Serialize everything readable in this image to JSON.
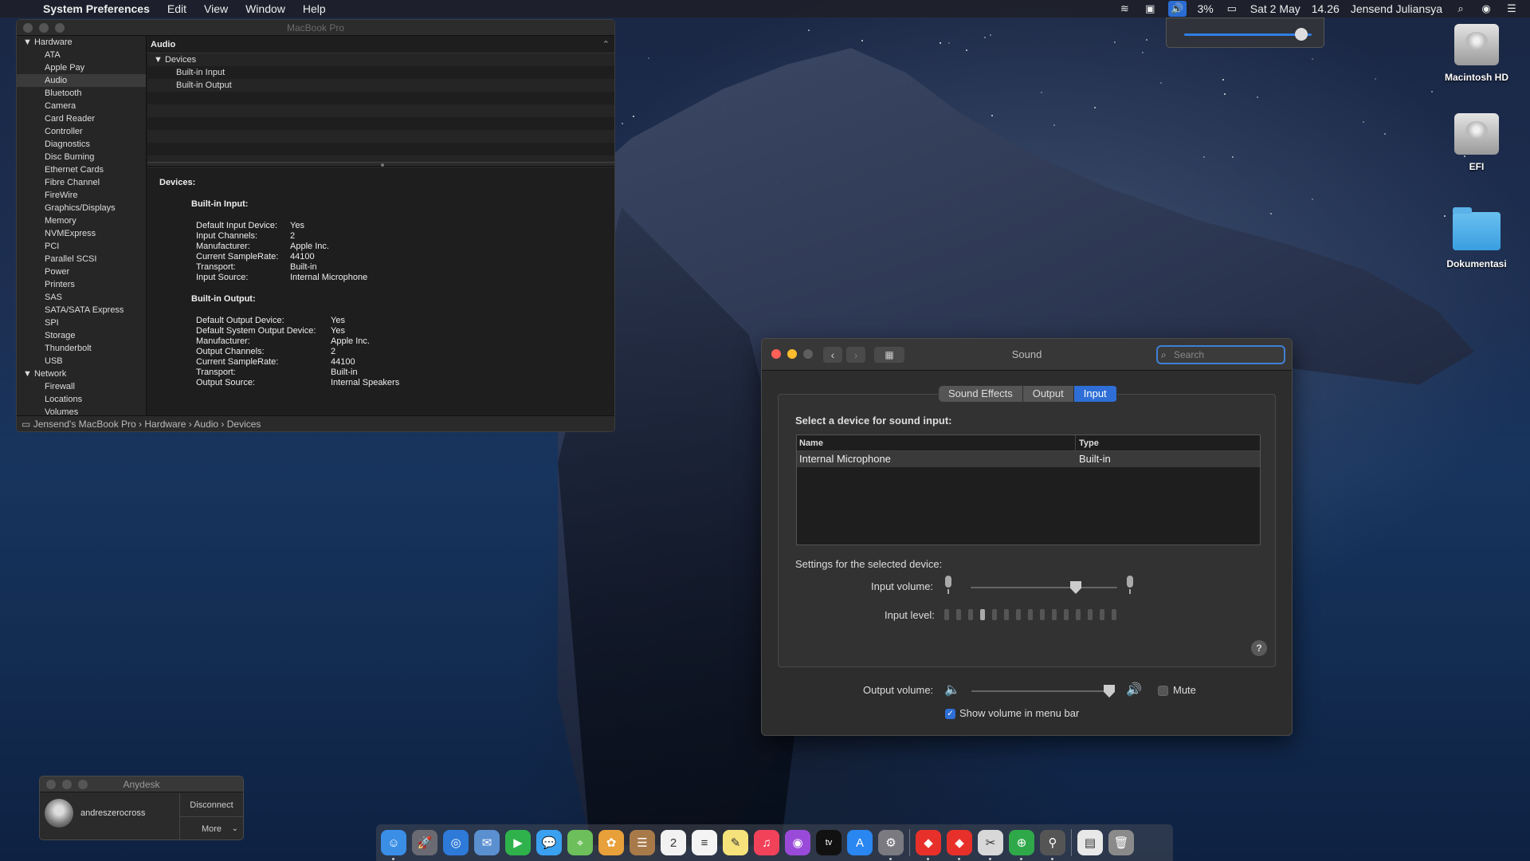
{
  "menubar": {
    "app_name": "System Preferences",
    "menus": [
      "Edit",
      "View",
      "Window",
      "Help"
    ],
    "battery": "3%",
    "date": "Sat 2 May",
    "time": "14.26",
    "user": "Jensend Juliansya"
  },
  "volume_popup": {
    "level_fraction": 0.92
  },
  "desktop_icons": [
    {
      "label": "Macintosh HD",
      "icon": "hard-disk-icon"
    },
    {
      "label": "EFI",
      "icon": "hard-disk-icon"
    },
    {
      "label": "Dokumentasi",
      "icon": "folder-icon"
    }
  ],
  "sysinfo": {
    "title": "MacBook Pro",
    "sidebar": [
      {
        "label": "Hardware",
        "group": true
      },
      {
        "label": "ATA"
      },
      {
        "label": "Apple Pay"
      },
      {
        "label": "Audio",
        "selected": true
      },
      {
        "label": "Bluetooth"
      },
      {
        "label": "Camera"
      },
      {
        "label": "Card Reader"
      },
      {
        "label": "Controller"
      },
      {
        "label": "Diagnostics"
      },
      {
        "label": "Disc Burning"
      },
      {
        "label": "Ethernet Cards"
      },
      {
        "label": "Fibre Channel"
      },
      {
        "label": "FireWire"
      },
      {
        "label": "Graphics/Displays"
      },
      {
        "label": "Memory"
      },
      {
        "label": "NVMExpress"
      },
      {
        "label": "PCI"
      },
      {
        "label": "Parallel SCSI"
      },
      {
        "label": "Power"
      },
      {
        "label": "Printers"
      },
      {
        "label": "SAS"
      },
      {
        "label": "SATA/SATA Express"
      },
      {
        "label": "SPI"
      },
      {
        "label": "Storage"
      },
      {
        "label": "Thunderbolt"
      },
      {
        "label": "USB"
      },
      {
        "label": "Network",
        "group": true
      },
      {
        "label": "Firewall"
      },
      {
        "label": "Locations"
      },
      {
        "label": "Volumes"
      }
    ],
    "list": {
      "header": "Audio",
      "group": "Devices",
      "items": [
        "Built-in Input",
        "Built-in Output"
      ]
    },
    "detail": {
      "heading": "Devices:",
      "input_title": "Built-in Input:",
      "input_rows": [
        [
          "Default Input Device:",
          "Yes"
        ],
        [
          "Input Channels:",
          "2"
        ],
        [
          "Manufacturer:",
          "Apple Inc."
        ],
        [
          "Current SampleRate:",
          "44100"
        ],
        [
          "Transport:",
          "Built-in"
        ],
        [
          "Input Source:",
          "Internal Microphone"
        ]
      ],
      "output_title": "Built-in Output:",
      "output_rows": [
        [
          "Default Output Device:",
          "Yes"
        ],
        [
          "Default System Output Device:",
          "Yes"
        ],
        [
          "Manufacturer:",
          "Apple Inc."
        ],
        [
          "Output Channels:",
          "2"
        ],
        [
          "Current SampleRate:",
          "44100"
        ],
        [
          "Transport:",
          "Built-in"
        ],
        [
          "Output Source:",
          "Internal Speakers"
        ]
      ]
    },
    "status_path": "Jensend's MacBook Pro › Hardware › Audio › Devices"
  },
  "sound": {
    "title": "Sound",
    "search_placeholder": "Search",
    "tabs": [
      {
        "label": "Sound Effects"
      },
      {
        "label": "Output"
      },
      {
        "label": "Input",
        "selected": true
      }
    ],
    "select_label": "Select a device for sound input:",
    "table": {
      "col_name": "Name",
      "col_type": "Type",
      "rows": [
        {
          "name": "Internal Microphone",
          "type": "Built-in"
        }
      ]
    },
    "settings_label": "Settings for the selected device:",
    "input_volume_label": "Input volume:",
    "input_volume_fraction": 0.72,
    "input_level_label": "Input level:",
    "input_level_bars": 15,
    "input_level_active": 4,
    "help": "?",
    "output_volume_label": "Output volume:",
    "output_volume_fraction": 0.96,
    "mute_label": "Mute",
    "mute_checked": false,
    "show_volume_label": "Show volume in menu bar",
    "show_volume_checked": true
  },
  "anydesk": {
    "title": "Anydesk",
    "user": "andreszerocross",
    "disconnect": "Disconnect",
    "more": "More"
  },
  "dock": {
    "items": [
      {
        "icon": "finder-icon",
        "color": "#3a8ee6",
        "glyph": "☺",
        "running": true
      },
      {
        "icon": "launchpad-icon",
        "color": "#6a6a72",
        "glyph": "🚀"
      },
      {
        "icon": "safari-icon",
        "color": "#2d7ad8",
        "glyph": "◎"
      },
      {
        "icon": "mail-icon",
        "color": "#5a8fd0",
        "glyph": "✉"
      },
      {
        "icon": "facetime-icon",
        "color": "#2fb24c",
        "glyph": "▶"
      },
      {
        "icon": "messages-icon",
        "color": "#3aa0f0",
        "glyph": "💬"
      },
      {
        "icon": "maps-icon",
        "color": "#6cbf5a",
        "glyph": "⌖"
      },
      {
        "icon": "photos-icon",
        "color": "#e8a03a",
        "glyph": "✿"
      },
      {
        "icon": "contacts-icon",
        "color": "#a87a4a",
        "glyph": "☰"
      },
      {
        "icon": "calendar-icon",
        "color": "#f2f2f2",
        "glyph": "2",
        "dark": true
      },
      {
        "icon": "reminders-icon",
        "color": "#f4f4f4",
        "glyph": "≡",
        "dark": true
      },
      {
        "icon": "notes-icon",
        "color": "#f6e27a",
        "glyph": "✎",
        "dark": true
      },
      {
        "icon": "music-icon",
        "color": "#f2425a",
        "glyph": "♫"
      },
      {
        "icon": "podcasts-icon",
        "color": "#9a4ad8",
        "glyph": "◉"
      },
      {
        "icon": "apple-tv-icon",
        "color": "#111111",
        "glyph": "tv"
      },
      {
        "icon": "app-store-icon",
        "color": "#2a86f0",
        "glyph": "A"
      },
      {
        "icon": "system-preferences-icon",
        "color": "#7a7a80",
        "glyph": "⚙",
        "running": true
      },
      {
        "sep": true
      },
      {
        "icon": "anydesk-icon",
        "color": "#e8302a",
        "glyph": "◆",
        "running": true
      },
      {
        "icon": "anydesk-alt-icon",
        "color": "#e8302a",
        "glyph": "◆",
        "running": true
      },
      {
        "icon": "preview-icon",
        "color": "#d8d8d8",
        "glyph": "✂",
        "dark": true,
        "running": true
      },
      {
        "icon": "globe-app-icon",
        "color": "#2fa84a",
        "glyph": "⊕",
        "running": true
      },
      {
        "icon": "usb-tool-icon",
        "color": "#555555",
        "glyph": "⚲",
        "running": true
      },
      {
        "sep": true
      },
      {
        "icon": "document-icon",
        "color": "#e8e8e8",
        "glyph": "▤",
        "dark": true
      },
      {
        "icon": "trash-icon",
        "color": "#8a8a8a",
        "glyph": "🗑"
      }
    ]
  }
}
